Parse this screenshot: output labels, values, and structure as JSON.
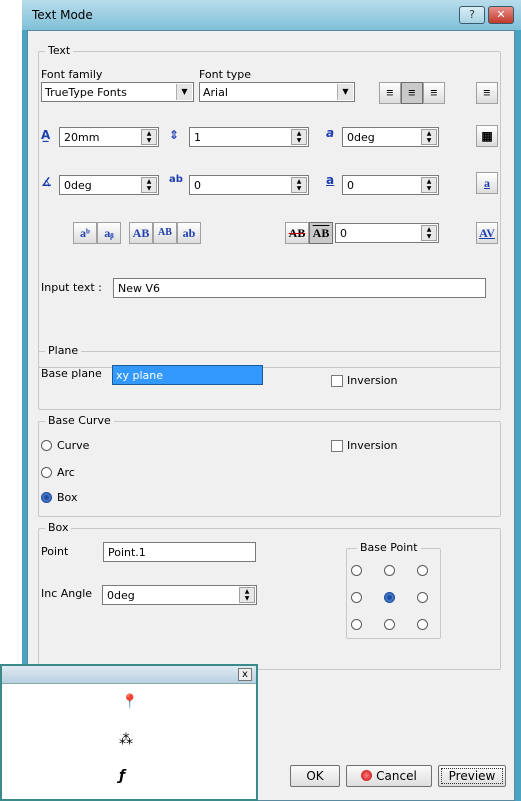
{
  "dialog": {
    "title": "Text Mode",
    "help": "?",
    "close": "✕"
  },
  "text_group": {
    "legend": "Text",
    "font_family_label": "Font family",
    "font_type_label": "Font type",
    "font_family_value": "TrueType Fonts",
    "font_type_value": "Arial",
    "height_value": "20mm",
    "spacing_value": "1",
    "slant_value": "0deg",
    "rotation_value": "0deg",
    "char_spacing_value": "0",
    "underline_value": "0",
    "strike_value": "0",
    "btn_superscript": "aᵇ",
    "btn_subscript": "aᵦ",
    "btn_upper": "AB",
    "btn_small_caps": "AB",
    "btn_lower": "ab",
    "btn_strike": "AB",
    "btn_overline": "AB",
    "btn_kerning": "AV",
    "input_text_label": "Input text :",
    "input_text_value": "New V6"
  },
  "plane_group": {
    "legend": "Plane",
    "base_plane_label": "Base plane",
    "base_plane_value": "xy plane",
    "inversion_label": "Inversion"
  },
  "curve_group": {
    "legend": "Base Curve",
    "curve_label": "Curve",
    "arc_label": "Arc",
    "box_label": "Box",
    "inversion_label": "Inversion"
  },
  "box_group": {
    "legend": "Box",
    "point_label": "Point",
    "point_value": "Point.1",
    "inc_angle_label": "Inc Angle",
    "inc_angle_value": "0deg",
    "base_point_legend": "Base Point"
  },
  "buttons": {
    "ok": "OK",
    "cancel": "Cancel",
    "preview": "Preview"
  },
  "toolbar": {
    "close": "x",
    "icons": [
      "pin-icon",
      "point-cloud-icon",
      "feature-icon"
    ]
  }
}
